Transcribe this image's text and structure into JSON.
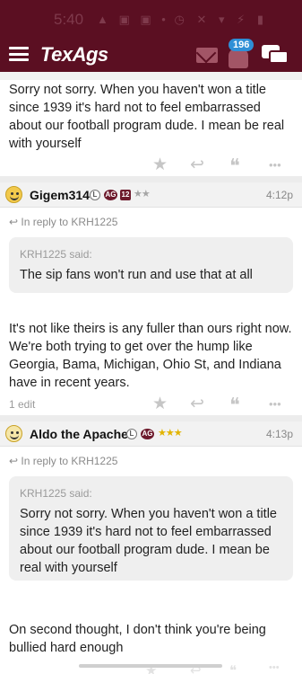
{
  "status_bar": {
    "time": "5:40",
    "left_icons": "▲ ▣ ▣ •",
    "right_icons": "◷ ✕ ▾ ⚡ ▮"
  },
  "header": {
    "logo": "TexAgs",
    "notification_count": "196",
    "icons": [
      "menu-icon",
      "mail-icon",
      "bell-icon",
      "chat-icon"
    ]
  },
  "colors": {
    "brand": "#5b0f22",
    "badge": "#2f8fd6",
    "quote_bg": "#efefef"
  },
  "posts": [
    {
      "text": "Sorry not sorry. When you haven't won a title since 1939 it's hard not to feel embarrassed about our football program dude. I mean be real with yourself"
    },
    {
      "username": "Gigem314",
      "badge_l": "L",
      "badge_ag": "AG",
      "badge_num": "12",
      "stars": "★★",
      "time": "4:12p",
      "reply_to": "In reply to KRH1225",
      "quote_author": "KRH1225 said:",
      "quote_text": "The sip fans won't run and use that at all",
      "text": "It's not like theirs is any fuller than ours right now. We're both trying to get over the hump like Georgia, Bama, Michigan, Ohio St, and Indiana have in recent years.",
      "edit_note": "1 edit"
    },
    {
      "username": "Aldo the Apache",
      "badge_l": "L",
      "badge_ag": "AG",
      "stars": "★★★",
      "time": "4:13p",
      "reply_to": "In reply to KRH1225",
      "quote_author": "KRH1225 said:",
      "quote_text": "Sorry not sorry. When you haven't won a title since 1939 it's hard not to feel embarrassed about our football program dude. I mean be real with yourself",
      "text": "On second thought, I don't think you're being bullied hard enough"
    }
  ],
  "actions": {
    "star": "★",
    "reply": "↩",
    "quote": "❝",
    "more": "•••"
  }
}
